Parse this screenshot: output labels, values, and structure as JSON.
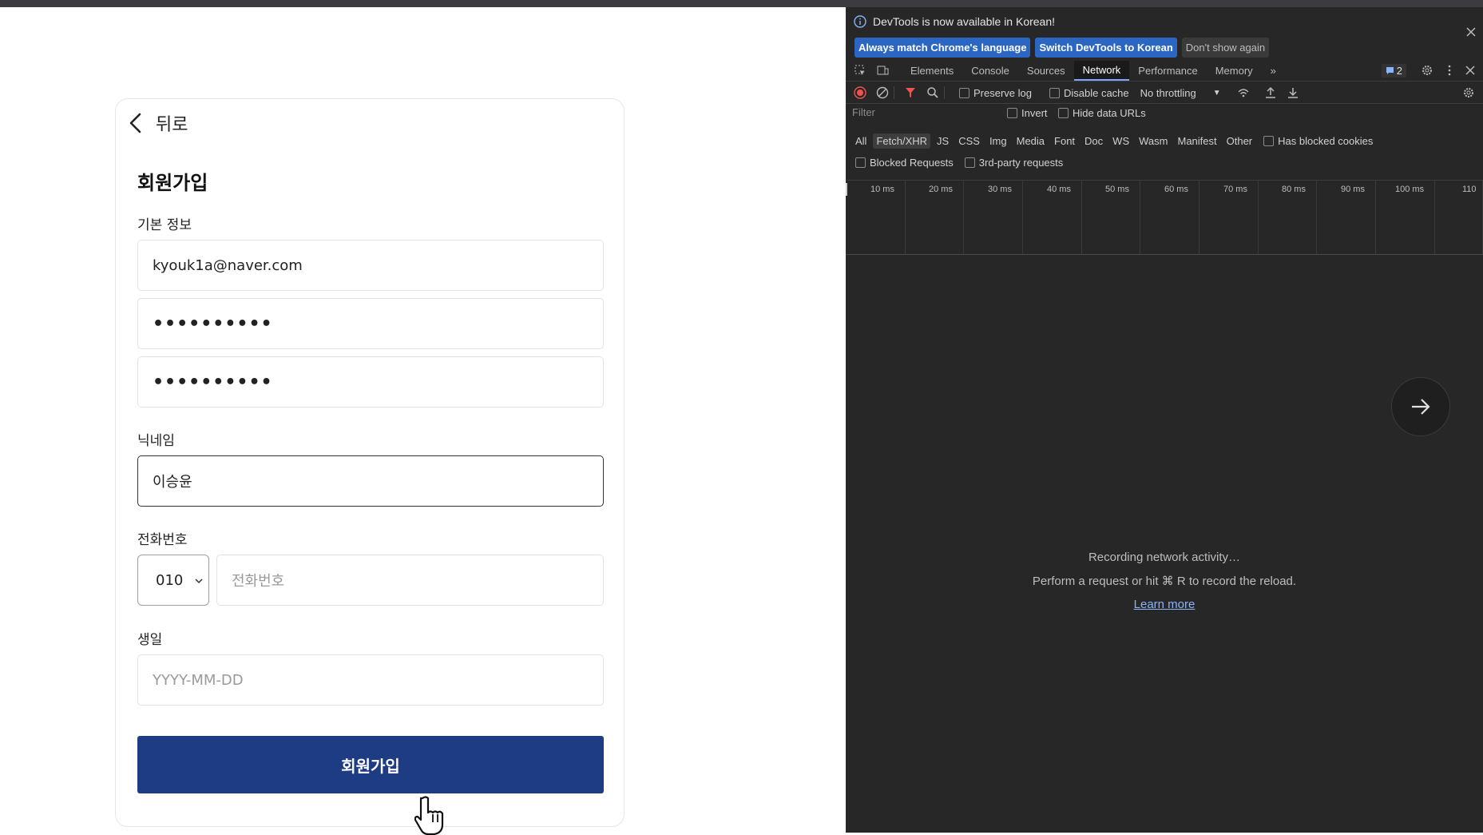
{
  "form": {
    "back_label": "뒤로",
    "title": "회원가입",
    "basic_info_label": "기본 정보",
    "email_value": "kyouk1a@naver.com",
    "password_value": "••••••••••",
    "password_confirm_value": "••••••••••",
    "nickname_label": "닉네임",
    "nickname_value": "이승윤",
    "phone_label": "전화번호",
    "phone_prefix": "010",
    "phone_placeholder": "전화번호",
    "birthday_label": "생일",
    "birthday_placeholder": "YYYY-MM-DD",
    "submit_label": "회원가입",
    "accent_color": "#1d3c84"
  },
  "devtools": {
    "banner_text": "DevTools is now available in Korean!",
    "banner_buttons": [
      "Always match Chrome's language",
      "Switch DevTools to Korean",
      "Don't show again"
    ],
    "tabs": [
      "Elements",
      "Console",
      "Sources",
      "Network",
      "Performance",
      "Memory"
    ],
    "active_tab": "Network",
    "issues_count": "2",
    "toolbar": {
      "preserve_log": "Preserve log",
      "disable_cache": "Disable cache",
      "throttling": "No throttling"
    },
    "filter_placeholder": "Filter",
    "invert": "Invert",
    "hide_data_urls": "Hide data URLs",
    "types": [
      "All",
      "Fetch/XHR",
      "JS",
      "CSS",
      "Img",
      "Media",
      "Font",
      "Doc",
      "WS",
      "Wasm",
      "Manifest",
      "Other"
    ],
    "active_type": "Fetch/XHR",
    "has_blocked_cookies": "Has blocked cookies",
    "blocked_requests": "Blocked Requests",
    "third_party": "3rd-party requests",
    "timeline_ticks": [
      "10 ms",
      "20 ms",
      "30 ms",
      "40 ms",
      "50 ms",
      "60 ms",
      "70 ms",
      "80 ms",
      "90 ms",
      "100 ms",
      "110"
    ],
    "empty_line1": "Recording network activity…",
    "empty_line2": "Perform a request or hit ⌘ R to record the reload.",
    "learn_more": "Learn more"
  }
}
